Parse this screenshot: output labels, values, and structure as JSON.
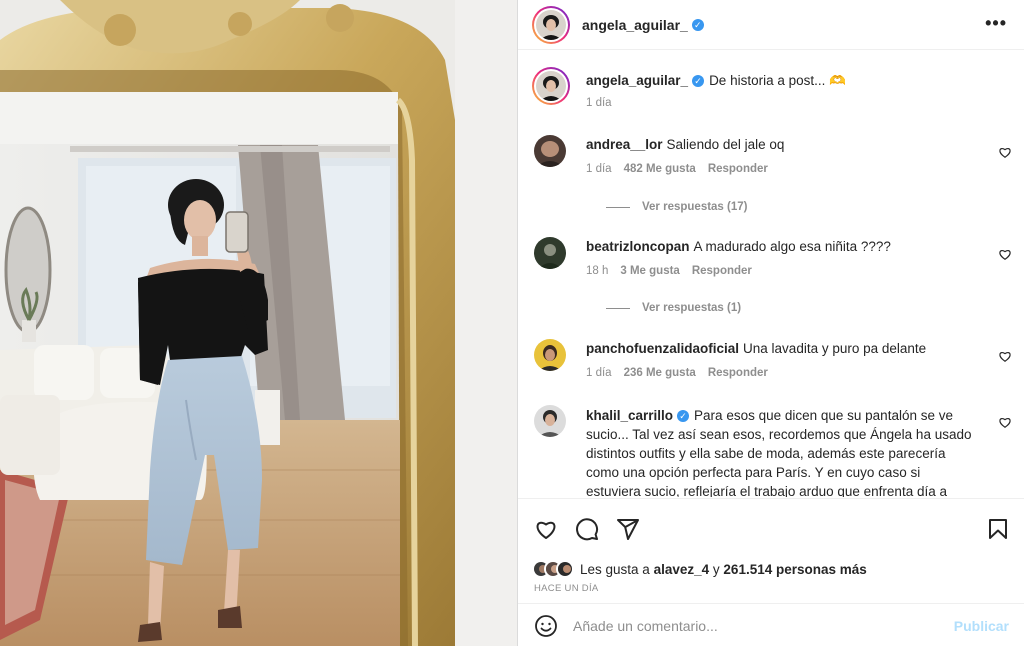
{
  "post": {
    "author": "angela_aguilar_",
    "verified": true,
    "more_icon": "ellipsis-icon",
    "caption": {
      "user": "angela_aguilar_",
      "text": "De historia a post... 🫶",
      "time": "1 día"
    },
    "comments": [
      {
        "user": "andrea__lor",
        "text": "Saliendo del jale oq",
        "time": "1 día",
        "likes": "482 Me gusta",
        "reply": "Responder",
        "view_replies": "Ver respuestas (17)"
      },
      {
        "user": "beatrizloncopan",
        "text": "A madurado algo esa niñita ????",
        "time": "18 h",
        "likes": "3 Me gusta",
        "reply": "Responder",
        "view_replies": "Ver respuestas (1)"
      },
      {
        "user": "panchofuenzalidaoficial",
        "text": "Una lavadita y puro pa delante",
        "time": "1 día",
        "likes": "236 Me gusta",
        "reply": "Responder"
      },
      {
        "user": "khalil_carrillo",
        "verified": true,
        "text": "Para esos que dicen que su pantalón se ve sucio... Tal vez así sean esos, recordemos que Ángela ha usado distintos outfits y ella sabe de moda, además este parecería como una opción perfecta para París. Y en cuyo caso si estuviera sucio, reflejaría el trabajo arduo que enfrenta día a"
      }
    ],
    "actions": {
      "like_icon": "heart-icon",
      "comment_icon": "comment-icon",
      "share_icon": "share-icon",
      "save_icon": "bookmark-icon"
    },
    "likes_summary": {
      "prefix": "Les gusta a",
      "first_user": "alavez_4",
      "joiner": "y",
      "others": "261.514 personas más"
    },
    "date": "HACE UN DÍA",
    "add_comment": {
      "emoji_icon": "emoji-icon",
      "placeholder": "Añade un comentario...",
      "publish_label": "Publicar"
    }
  },
  "colors": {
    "accent": "#0095f6",
    "verified": "#3897f0",
    "muted": "#8e8e8e",
    "publish_disabled": "#b2dffc"
  }
}
